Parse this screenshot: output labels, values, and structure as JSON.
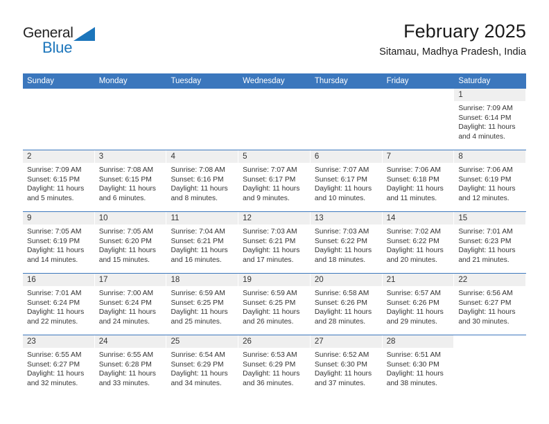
{
  "logo": {
    "word_one": "General",
    "word_two": "Blue",
    "triangle_icon": "triangle-icon",
    "accent_color": "#1b75bb"
  },
  "header": {
    "title": "February 2025",
    "subtitle": "Sitamau, Madhya Pradesh, India"
  },
  "colors": {
    "header_blue": "#3b77bd",
    "daynum_band": "#efefef",
    "text": "#333333"
  },
  "weekdays": [
    "Sunday",
    "Monday",
    "Tuesday",
    "Wednesday",
    "Thursday",
    "Friday",
    "Saturday"
  ],
  "weeks": [
    [
      {
        "day": "",
        "sunrise": "",
        "sunset": "",
        "daylight": "",
        "empty": true
      },
      {
        "day": "",
        "sunrise": "",
        "sunset": "",
        "daylight": "",
        "empty": true
      },
      {
        "day": "",
        "sunrise": "",
        "sunset": "",
        "daylight": "",
        "empty": true
      },
      {
        "day": "",
        "sunrise": "",
        "sunset": "",
        "daylight": "",
        "empty": true
      },
      {
        "day": "",
        "sunrise": "",
        "sunset": "",
        "daylight": "",
        "empty": true
      },
      {
        "day": "",
        "sunrise": "",
        "sunset": "",
        "daylight": "",
        "empty": true
      },
      {
        "day": "1",
        "sunrise": "Sunrise: 7:09 AM",
        "sunset": "Sunset: 6:14 PM",
        "daylight": "Daylight: 11 hours and 4 minutes.",
        "empty": false
      }
    ],
    [
      {
        "day": "2",
        "sunrise": "Sunrise: 7:09 AM",
        "sunset": "Sunset: 6:15 PM",
        "daylight": "Daylight: 11 hours and 5 minutes.",
        "empty": false
      },
      {
        "day": "3",
        "sunrise": "Sunrise: 7:08 AM",
        "sunset": "Sunset: 6:15 PM",
        "daylight": "Daylight: 11 hours and 6 minutes.",
        "empty": false
      },
      {
        "day": "4",
        "sunrise": "Sunrise: 7:08 AM",
        "sunset": "Sunset: 6:16 PM",
        "daylight": "Daylight: 11 hours and 8 minutes.",
        "empty": false
      },
      {
        "day": "5",
        "sunrise": "Sunrise: 7:07 AM",
        "sunset": "Sunset: 6:17 PM",
        "daylight": "Daylight: 11 hours and 9 minutes.",
        "empty": false
      },
      {
        "day": "6",
        "sunrise": "Sunrise: 7:07 AM",
        "sunset": "Sunset: 6:17 PM",
        "daylight": "Daylight: 11 hours and 10 minutes.",
        "empty": false
      },
      {
        "day": "7",
        "sunrise": "Sunrise: 7:06 AM",
        "sunset": "Sunset: 6:18 PM",
        "daylight": "Daylight: 11 hours and 11 minutes.",
        "empty": false
      },
      {
        "day": "8",
        "sunrise": "Sunrise: 7:06 AM",
        "sunset": "Sunset: 6:19 PM",
        "daylight": "Daylight: 11 hours and 12 minutes.",
        "empty": false
      }
    ],
    [
      {
        "day": "9",
        "sunrise": "Sunrise: 7:05 AM",
        "sunset": "Sunset: 6:19 PM",
        "daylight": "Daylight: 11 hours and 14 minutes.",
        "empty": false
      },
      {
        "day": "10",
        "sunrise": "Sunrise: 7:05 AM",
        "sunset": "Sunset: 6:20 PM",
        "daylight": "Daylight: 11 hours and 15 minutes.",
        "empty": false
      },
      {
        "day": "11",
        "sunrise": "Sunrise: 7:04 AM",
        "sunset": "Sunset: 6:21 PM",
        "daylight": "Daylight: 11 hours and 16 minutes.",
        "empty": false
      },
      {
        "day": "12",
        "sunrise": "Sunrise: 7:03 AM",
        "sunset": "Sunset: 6:21 PM",
        "daylight": "Daylight: 11 hours and 17 minutes.",
        "empty": false
      },
      {
        "day": "13",
        "sunrise": "Sunrise: 7:03 AM",
        "sunset": "Sunset: 6:22 PM",
        "daylight": "Daylight: 11 hours and 18 minutes.",
        "empty": false
      },
      {
        "day": "14",
        "sunrise": "Sunrise: 7:02 AM",
        "sunset": "Sunset: 6:22 PM",
        "daylight": "Daylight: 11 hours and 20 minutes.",
        "empty": false
      },
      {
        "day": "15",
        "sunrise": "Sunrise: 7:01 AM",
        "sunset": "Sunset: 6:23 PM",
        "daylight": "Daylight: 11 hours and 21 minutes.",
        "empty": false
      }
    ],
    [
      {
        "day": "16",
        "sunrise": "Sunrise: 7:01 AM",
        "sunset": "Sunset: 6:24 PM",
        "daylight": "Daylight: 11 hours and 22 minutes.",
        "empty": false
      },
      {
        "day": "17",
        "sunrise": "Sunrise: 7:00 AM",
        "sunset": "Sunset: 6:24 PM",
        "daylight": "Daylight: 11 hours and 24 minutes.",
        "empty": false
      },
      {
        "day": "18",
        "sunrise": "Sunrise: 6:59 AM",
        "sunset": "Sunset: 6:25 PM",
        "daylight": "Daylight: 11 hours and 25 minutes.",
        "empty": false
      },
      {
        "day": "19",
        "sunrise": "Sunrise: 6:59 AM",
        "sunset": "Sunset: 6:25 PM",
        "daylight": "Daylight: 11 hours and 26 minutes.",
        "empty": false
      },
      {
        "day": "20",
        "sunrise": "Sunrise: 6:58 AM",
        "sunset": "Sunset: 6:26 PM",
        "daylight": "Daylight: 11 hours and 28 minutes.",
        "empty": false
      },
      {
        "day": "21",
        "sunrise": "Sunrise: 6:57 AM",
        "sunset": "Sunset: 6:26 PM",
        "daylight": "Daylight: 11 hours and 29 minutes.",
        "empty": false
      },
      {
        "day": "22",
        "sunrise": "Sunrise: 6:56 AM",
        "sunset": "Sunset: 6:27 PM",
        "daylight": "Daylight: 11 hours and 30 minutes.",
        "empty": false
      }
    ],
    [
      {
        "day": "23",
        "sunrise": "Sunrise: 6:55 AM",
        "sunset": "Sunset: 6:27 PM",
        "daylight": "Daylight: 11 hours and 32 minutes.",
        "empty": false
      },
      {
        "day": "24",
        "sunrise": "Sunrise: 6:55 AM",
        "sunset": "Sunset: 6:28 PM",
        "daylight": "Daylight: 11 hours and 33 minutes.",
        "empty": false
      },
      {
        "day": "25",
        "sunrise": "Sunrise: 6:54 AM",
        "sunset": "Sunset: 6:29 PM",
        "daylight": "Daylight: 11 hours and 34 minutes.",
        "empty": false
      },
      {
        "day": "26",
        "sunrise": "Sunrise: 6:53 AM",
        "sunset": "Sunset: 6:29 PM",
        "daylight": "Daylight: 11 hours and 36 minutes.",
        "empty": false
      },
      {
        "day": "27",
        "sunrise": "Sunrise: 6:52 AM",
        "sunset": "Sunset: 6:30 PM",
        "daylight": "Daylight: 11 hours and 37 minutes.",
        "empty": false
      },
      {
        "day": "28",
        "sunrise": "Sunrise: 6:51 AM",
        "sunset": "Sunset: 6:30 PM",
        "daylight": "Daylight: 11 hours and 38 minutes.",
        "empty": false
      },
      {
        "day": "",
        "sunrise": "",
        "sunset": "",
        "daylight": "",
        "empty": true
      }
    ]
  ]
}
